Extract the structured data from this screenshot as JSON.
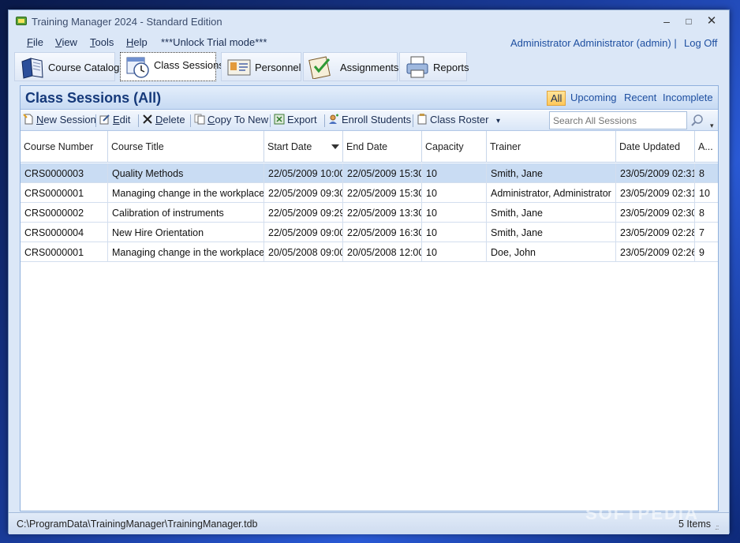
{
  "window": {
    "title": "Training Manager 2024 - Standard Edition",
    "controls": {
      "minimize": "–",
      "maximize": "□",
      "close": "✕"
    }
  },
  "menu": {
    "file": "F",
    "file_rest": "ile",
    "view": "V",
    "view_rest": "iew",
    "tools": "T",
    "tools_rest": "ools",
    "help": "H",
    "help_rest": "elp",
    "trial": "***Unlock Trial mode***",
    "user": "Administrator Administrator (admin)  |",
    "logoff": "Log Off"
  },
  "nav_tabs": [
    {
      "label": "Course Catalog",
      "icon": "book-icon"
    },
    {
      "label": "Class Sessions",
      "icon": "clock-icon",
      "active": true
    },
    {
      "label": "Personnel",
      "icon": "id-card-icon"
    },
    {
      "label": "Assignments",
      "icon": "clipboard-check-icon"
    },
    {
      "label": "Reports",
      "icon": "printer-icon"
    }
  ],
  "panel": {
    "title": "Class Sessions (All)",
    "filters": [
      "All",
      "Upcoming",
      "Recent",
      "Incomplete"
    ],
    "active_filter": "All"
  },
  "toolbar": {
    "new_session": "N",
    "new_session_rest": "ew Session",
    "edit": "E",
    "edit_rest": "dit",
    "delete": "D",
    "delete_rest": "elete",
    "copy": "C",
    "copy_rest": "opy To New",
    "export": "Export",
    "enroll": "Enroll Students",
    "roster": "Class Roster",
    "roster_arrow": "▾",
    "search_placeholder": "Search All Sessions",
    "overflow": "▾"
  },
  "grid": {
    "columns": [
      "Course Number",
      "Course Title",
      "Start Date",
      "End Date",
      "Capacity",
      "Trainer",
      "Date Updated",
      "A..."
    ],
    "rows": [
      [
        "CRS0000003",
        "Quality Methods",
        "22/05/2009 10:00",
        "22/05/2009 15:30",
        "10",
        "Smith, Jane",
        "23/05/2009 02:31",
        "8"
      ],
      [
        "CRS0000001",
        "Managing change in the workplace",
        "22/05/2009 09:30",
        "22/05/2009 15:30",
        "10",
        "Administrator, Administrator",
        "23/05/2009 02:31",
        "10"
      ],
      [
        "CRS0000002",
        "Calibration of instruments",
        "22/05/2009 09:29",
        "22/05/2009 13:30",
        "10",
        "Smith, Jane",
        "23/05/2009 02:30",
        "8"
      ],
      [
        "CRS0000004",
        "New Hire Orientation",
        "22/05/2009 09:00",
        "22/05/2009 16:30",
        "10",
        "Smith, Jane",
        "23/05/2009 02:28",
        "7"
      ],
      [
        "CRS0000001",
        "Managing change in the workplace",
        "20/05/2008 09:00",
        "20/05/2008 12:00",
        "10",
        "Doe, John",
        "23/05/2009 02:26",
        "9"
      ]
    ],
    "selected_row": 0
  },
  "status": {
    "path": "C:\\ProgramData\\TrainingManager\\TrainingManager.tdb",
    "count": "5 Items",
    "grip": ".::"
  },
  "watermark": "SOFTPEDIA"
}
